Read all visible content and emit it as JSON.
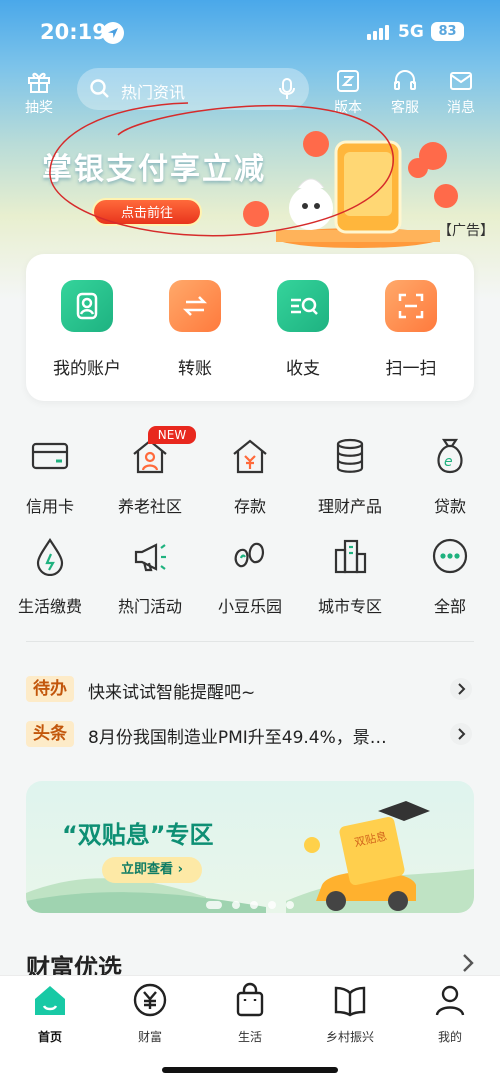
{
  "status_bar": {
    "time": "20:19",
    "network": "5G",
    "battery": "83"
  },
  "header": {
    "left_label": "抽奖",
    "search_placeholder": "热门资讯",
    "right_items": [
      {
        "label": "版本"
      },
      {
        "label": "客服"
      },
      {
        "label": "消息"
      }
    ]
  },
  "banner": {
    "title": "掌银支付享立减",
    "button": "点击前往",
    "ad_label": "【广告】"
  },
  "quick_actions": [
    {
      "label": "我的账户",
      "icon": "account-icon",
      "color": "#2cc28f"
    },
    {
      "label": "转账",
      "icon": "transfer-icon",
      "color": "#ff8a4a"
    },
    {
      "label": "收支",
      "icon": "income-expense-icon",
      "color": "#2cc28f"
    },
    {
      "label": "扫一扫",
      "icon": "scan-icon",
      "color": "#ff8a4a"
    }
  ],
  "grid": [
    {
      "label": "信用卡",
      "icon": "credit-card-icon"
    },
    {
      "label": "养老社区",
      "icon": "elderly-community-icon",
      "badge": "NEW"
    },
    {
      "label": "存款",
      "icon": "deposit-icon"
    },
    {
      "label": "理财产品",
      "icon": "wealth-product-icon"
    },
    {
      "label": "贷款",
      "icon": "loan-icon"
    },
    {
      "label": "生活缴费",
      "icon": "utility-payment-icon"
    },
    {
      "label": "热门活动",
      "icon": "hot-activity-icon"
    },
    {
      "label": "小豆乐园",
      "icon": "bean-park-icon"
    },
    {
      "label": "城市专区",
      "icon": "city-zone-icon"
    },
    {
      "label": "全部",
      "icon": "more-icon"
    }
  ],
  "notices": [
    {
      "tag": "待办",
      "text": "快来试试智能提醒吧~"
    },
    {
      "tag": "头条",
      "text": "8月份我国制造业PMI升至49.4%，景…"
    }
  ],
  "promo": {
    "title": "“双贴息”专区",
    "button": "立即查看 ›",
    "tag": "双贴息"
  },
  "section": {
    "title": "财富优选"
  },
  "tabbar": [
    {
      "label": "首页",
      "icon": "home-icon",
      "active": true
    },
    {
      "label": "财富",
      "icon": "wealth-icon"
    },
    {
      "label": "生活",
      "icon": "life-bag-icon"
    },
    {
      "label": "乡村振兴",
      "icon": "rural-book-icon"
    },
    {
      "label": "我的",
      "icon": "profile-icon"
    }
  ],
  "colors": {
    "brand_green": "#0e8f74",
    "accent_orange": "#ff8a4a",
    "new_red": "#e8281e"
  }
}
